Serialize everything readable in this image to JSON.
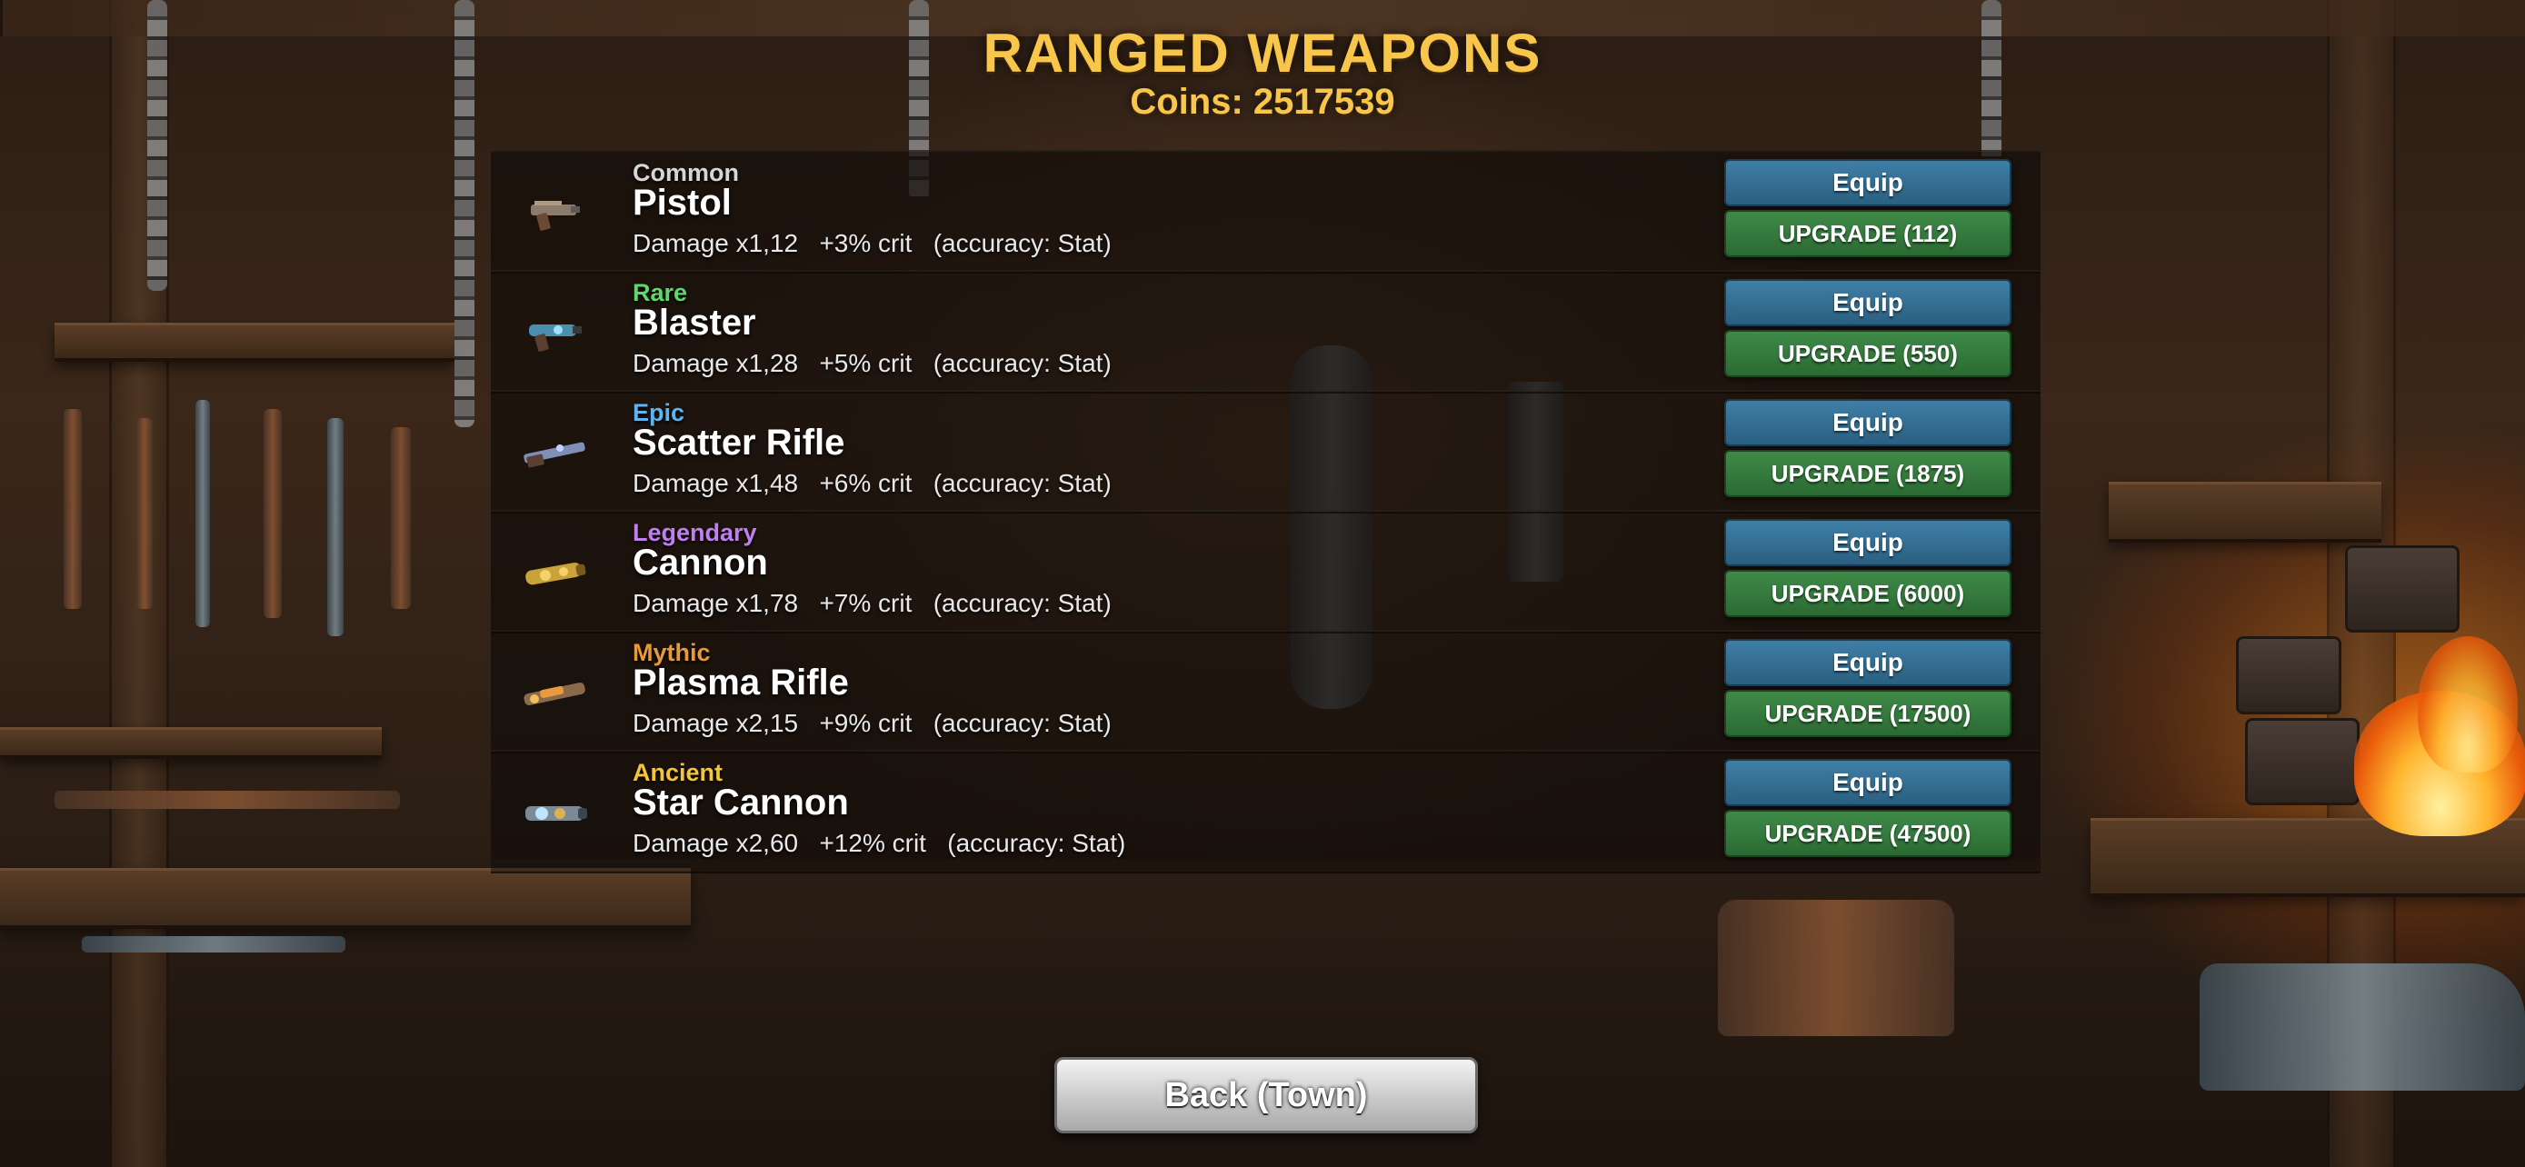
{
  "header": {
    "title": "RANGED WEAPONS",
    "coins_label": "Coins: 2517539"
  },
  "colors": {
    "title_gold": "#f7c64a",
    "equip_blue": "#2f6f96",
    "upgrade_green": "#2f7a3a",
    "Common": "#d6d6d6",
    "Rare": "#5fd86a",
    "Epic": "#5fb4f0",
    "Legendary": "#c07ef0",
    "Mythic": "#e79a3c",
    "Ancient": "#f3c43c"
  },
  "weapons": [
    {
      "rarity": "Common",
      "name": "Pistol",
      "stats": "Damage x1,12   +3% crit   (accuracy: Stat)",
      "equip_label": "Equip",
      "upgrade_label": "UPGRADE (112)",
      "icon": "pistol-icon"
    },
    {
      "rarity": "Rare",
      "name": "Blaster",
      "stats": "Damage x1,28   +5% crit   (accuracy: Stat)",
      "equip_label": "Equip",
      "upgrade_label": "UPGRADE (550)",
      "icon": "blaster-icon"
    },
    {
      "rarity": "Epic",
      "name": "Scatter Rifle",
      "stats": "Damage x1,48   +6% crit   (accuracy: Stat)",
      "equip_label": "Equip",
      "upgrade_label": "UPGRADE (1875)",
      "icon": "scatter-rifle-icon"
    },
    {
      "rarity": "Legendary",
      "name": "Cannon",
      "stats": "Damage x1,78   +7% crit   (accuracy: Stat)",
      "equip_label": "Equip",
      "upgrade_label": "UPGRADE (6000)",
      "icon": "cannon-icon"
    },
    {
      "rarity": "Mythic",
      "name": "Plasma Rifle",
      "stats": "Damage x2,15   +9% crit   (accuracy: Stat)",
      "equip_label": "Equip",
      "upgrade_label": "UPGRADE (17500)",
      "icon": "plasma-rifle-icon"
    },
    {
      "rarity": "Ancient",
      "name": "Star Cannon",
      "stats": "Damage x2,60   +12% crit   (accuracy: Stat)",
      "equip_label": "Equip",
      "upgrade_label": "UPGRADE (47500)",
      "icon": "star-cannon-icon"
    }
  ],
  "footer": {
    "back_label": "Back (Town)"
  }
}
